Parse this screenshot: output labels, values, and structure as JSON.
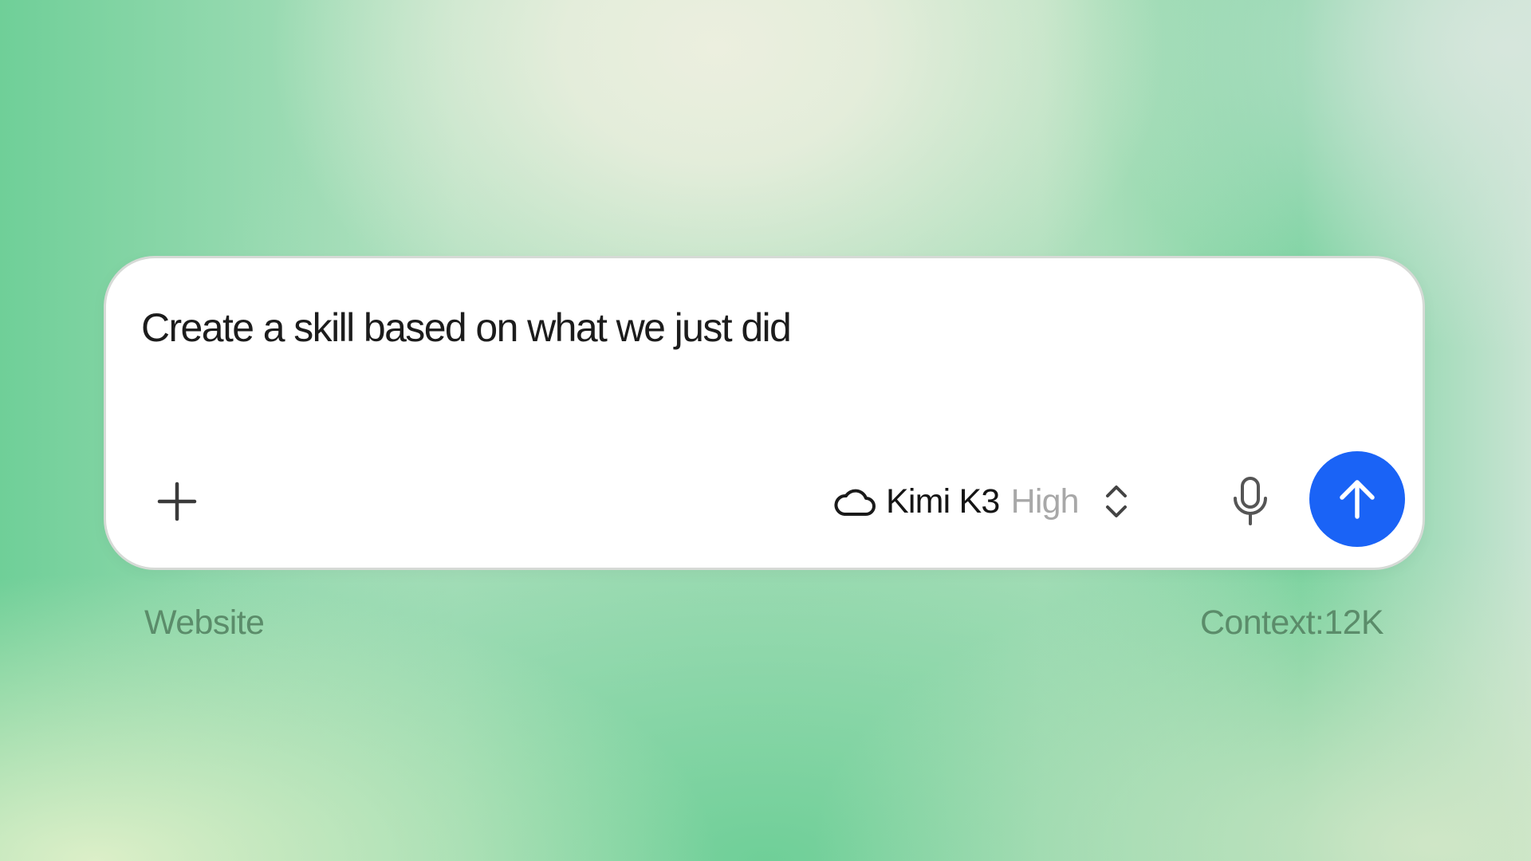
{
  "composer": {
    "prompt_text": "Create a skill based on what we just did",
    "add_icon": "plus-icon",
    "model": {
      "icon": "cloud-icon",
      "name": "Kimi K3",
      "effort": "High",
      "toggle_icon": "chevron-up-down-icon"
    },
    "mic_icon": "microphone-icon",
    "send_icon": "arrow-up-icon",
    "send_color": "#1a63f6"
  },
  "footer": {
    "left_label": "Website",
    "right_label": "Context:12K"
  }
}
